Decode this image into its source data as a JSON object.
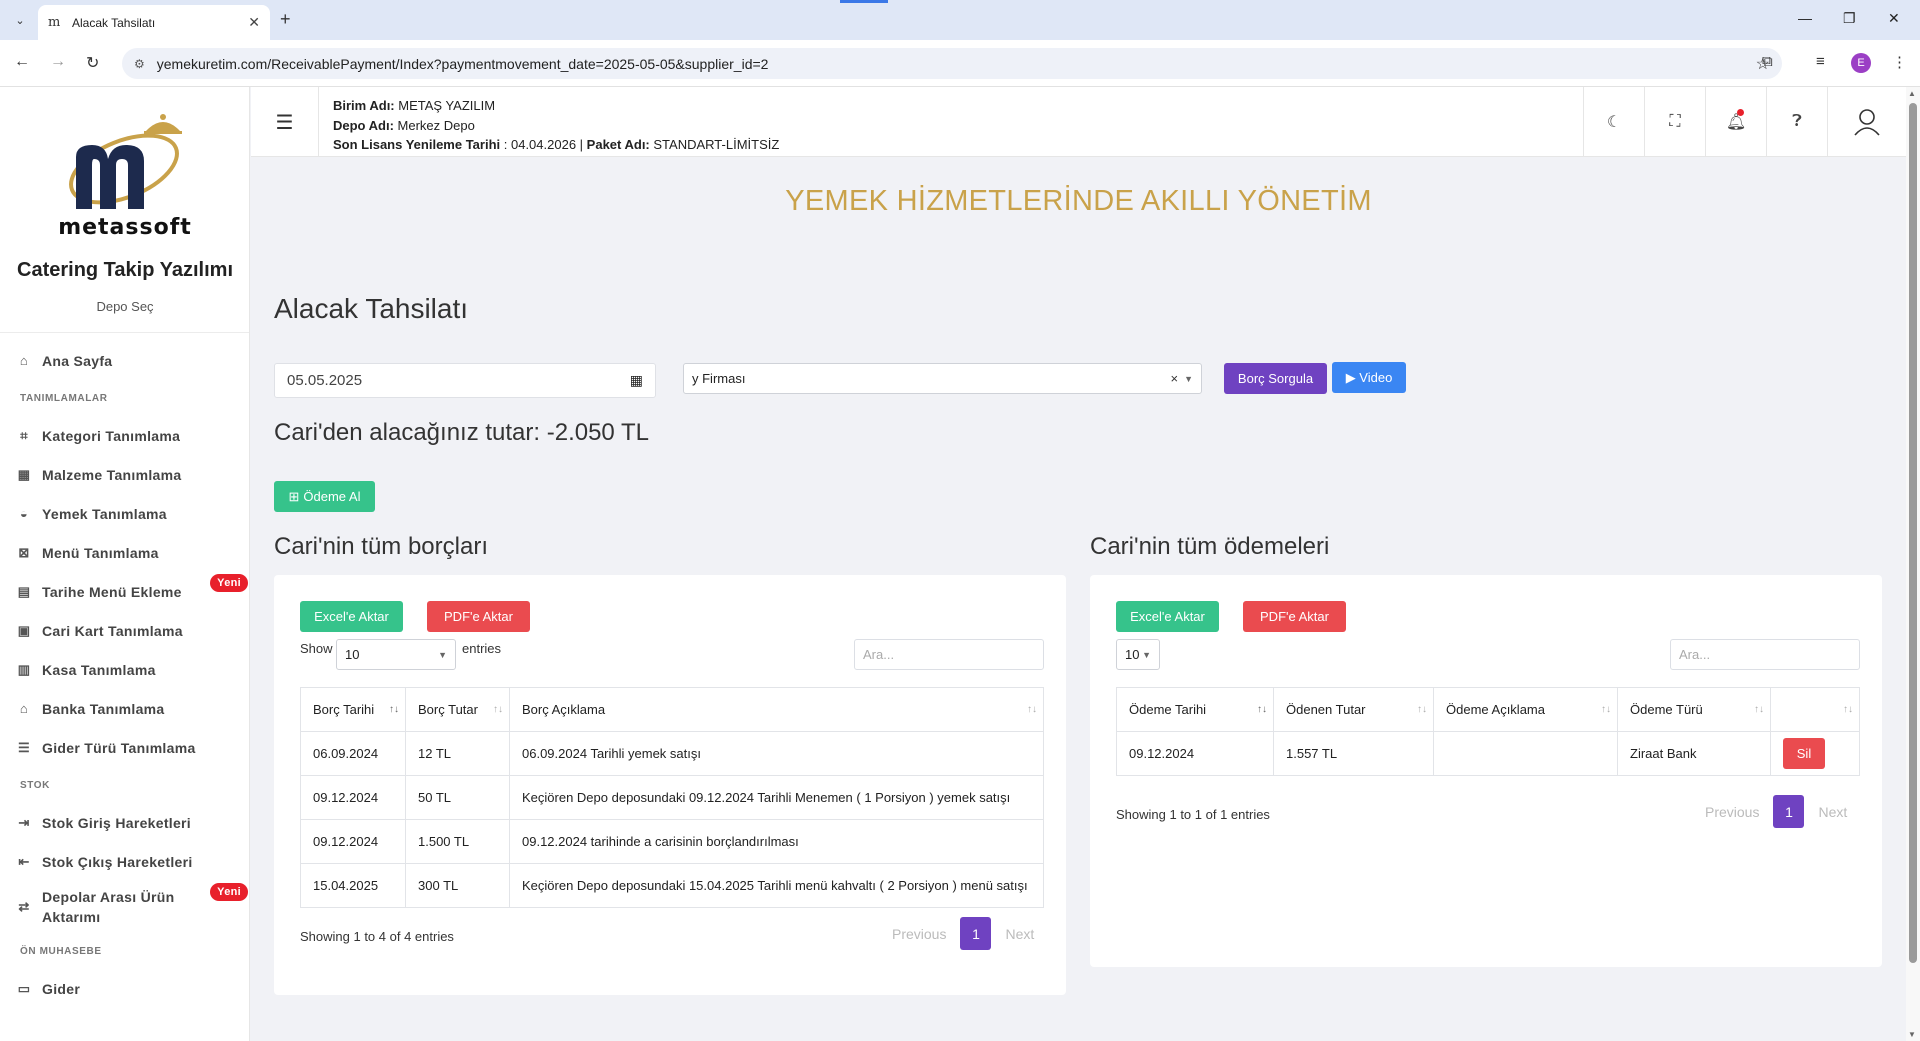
{
  "browser": {
    "tab_title": "Alacak Tahsilatı",
    "favicon": "m",
    "url": "yemekuretim.com/ReceivablePayment/Index?paymentmovement_date=2025-05-05&supplier_id=2",
    "profile_initial": "E"
  },
  "sidebar": {
    "logo_text": "metassoft",
    "app_title": "Catering Takip Yazılımı",
    "depot_select": "Depo Seç",
    "items": [
      {
        "label": "Ana Sayfa",
        "icon": "home-icon"
      },
      {
        "section": "TANIMLAMALAR"
      },
      {
        "label": "Kategori Tanımlama",
        "icon": "tag-icon"
      },
      {
        "label": "Malzeme Tanımlama",
        "icon": "boxes-icon"
      },
      {
        "label": "Yemek Tanımlama",
        "icon": "bowl-icon"
      },
      {
        "label": "Menü Tanımlama",
        "icon": "menu-card-icon"
      },
      {
        "label": "Tarihe Menü Ekleme",
        "icon": "calendar-icon",
        "badge": "Yeni"
      },
      {
        "label": "Cari Kart Tanımlama",
        "icon": "id-card-icon"
      },
      {
        "label": "Kasa Tanımlama",
        "icon": "cash-register-icon"
      },
      {
        "label": "Banka Tanımlama",
        "icon": "bank-icon"
      },
      {
        "label": "Gider Türü Tanımlama",
        "icon": "list-icon"
      },
      {
        "section": "STOK"
      },
      {
        "label": "Stok Giriş Hareketleri",
        "icon": "stock-in-icon"
      },
      {
        "label": "Stok Çıkış Hareketleri",
        "icon": "stock-out-icon"
      },
      {
        "label": "Depolar Arası Ürün Aktarımı",
        "icon": "transfer-icon",
        "badge": "Yeni"
      },
      {
        "section": "ÖN MUHASEBE"
      },
      {
        "label": "Gider",
        "icon": "expense-icon"
      }
    ]
  },
  "header": {
    "birim_label": "Birim Adı:",
    "birim_value": "METAŞ YAZILIM",
    "depo_label": "Depo Adı:",
    "depo_value": "Merkez Depo",
    "license_label": "Son Lisans Yenileme Tarihi",
    "license_value": ": 04.04.2026 |",
    "package_label": "Paket Adı:",
    "package_value": "STANDART-LİMİTSİZ"
  },
  "main": {
    "slogan": "YEMEK HİZMETLERİNDE AKILLI YÖNETİM",
    "page_title": "Alacak Tahsilatı",
    "date_value": "05.05.2025",
    "supplier_value": "y Firması",
    "borc_sorgula": "Borç Sorgula",
    "video": "▶ Video",
    "amount_text": "Cari'den alacağınız tutar: -2.050 TL",
    "odeme_al": "Ödeme Al"
  },
  "debts": {
    "title": "Cari'nin tüm borçları",
    "excel": "Excel'e Aktar",
    "pdf": "PDF'e Aktar",
    "show": "Show",
    "length": "10",
    "entries": "entries",
    "search_placeholder": "Ara...",
    "columns": [
      "Borç Tarihi",
      "Borç Tutar",
      "Borç Açıklama"
    ],
    "rows": [
      [
        "06.09.2024",
        "12 TL",
        "06.09.2024 Tarihli yemek satışı"
      ],
      [
        "09.12.2024",
        "50 TL",
        "Keçiören Depo deposundaki 09.12.2024 Tarihli Menemen ( 1 Porsiyon ) yemek satışı"
      ],
      [
        "09.12.2024",
        "1.500 TL",
        "09.12.2024 tarihinde a carisinin borçlandırılması"
      ],
      [
        "15.04.2025",
        "300 TL",
        "Keçiören Depo deposundaki 15.04.2025 Tarihli menü kahvaltı ( 2 Porsiyon ) menü satışı"
      ]
    ],
    "showing": "Showing 1 to 4 of 4 entries",
    "previous": "Previous",
    "page": "1",
    "next": "Next"
  },
  "payments": {
    "title": "Cari'nin tüm ödemeleri",
    "excel": "Excel'e Aktar",
    "pdf": "PDF'e Aktar",
    "length": "10",
    "search_placeholder": "Ara...",
    "columns": [
      "Ödeme Tarihi",
      "Ödenen Tutar",
      "Ödeme Açıklama",
      "Ödeme Türü",
      ""
    ],
    "rows": [
      [
        "09.12.2024",
        "1.557 TL",
        "",
        "Ziraat Bank",
        "Sil"
      ]
    ],
    "showing": "Showing 1 to 1 of 1 entries",
    "previous": "Previous",
    "page": "1",
    "next": "Next"
  },
  "colors": {
    "accent": "#6f42c1",
    "slogan": "#c9a24a",
    "success": "#36c38b",
    "danger": "#ea4b4f",
    "info": "#3a86f3"
  }
}
